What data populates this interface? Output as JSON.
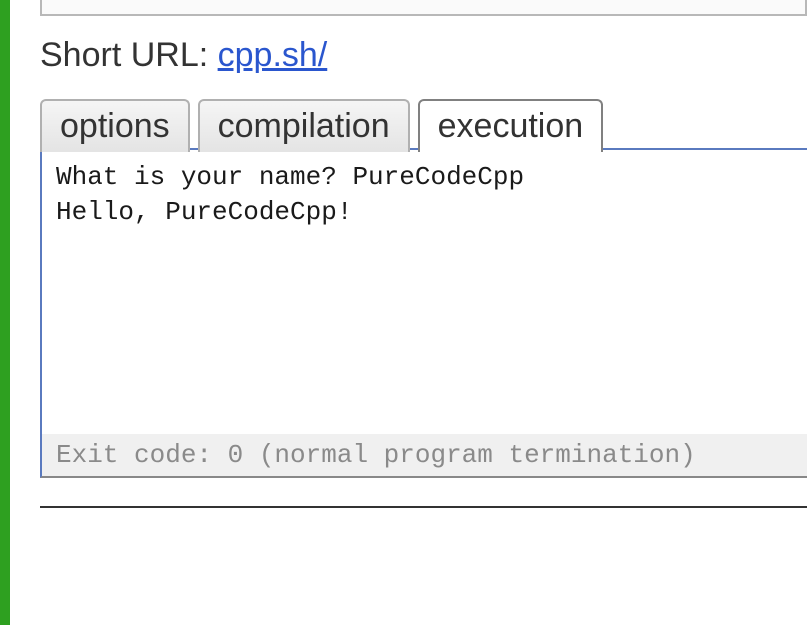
{
  "shortUrl": {
    "label": "Short URL: ",
    "link": "cpp.sh/"
  },
  "tabs": {
    "options": "options",
    "compilation": "compilation",
    "execution": "execution"
  },
  "output": {
    "lines": "What is your name? PureCodeCpp\nHello, PureCodeCpp!"
  },
  "exit": {
    "text": "Exit code: 0 (normal program termination)"
  }
}
